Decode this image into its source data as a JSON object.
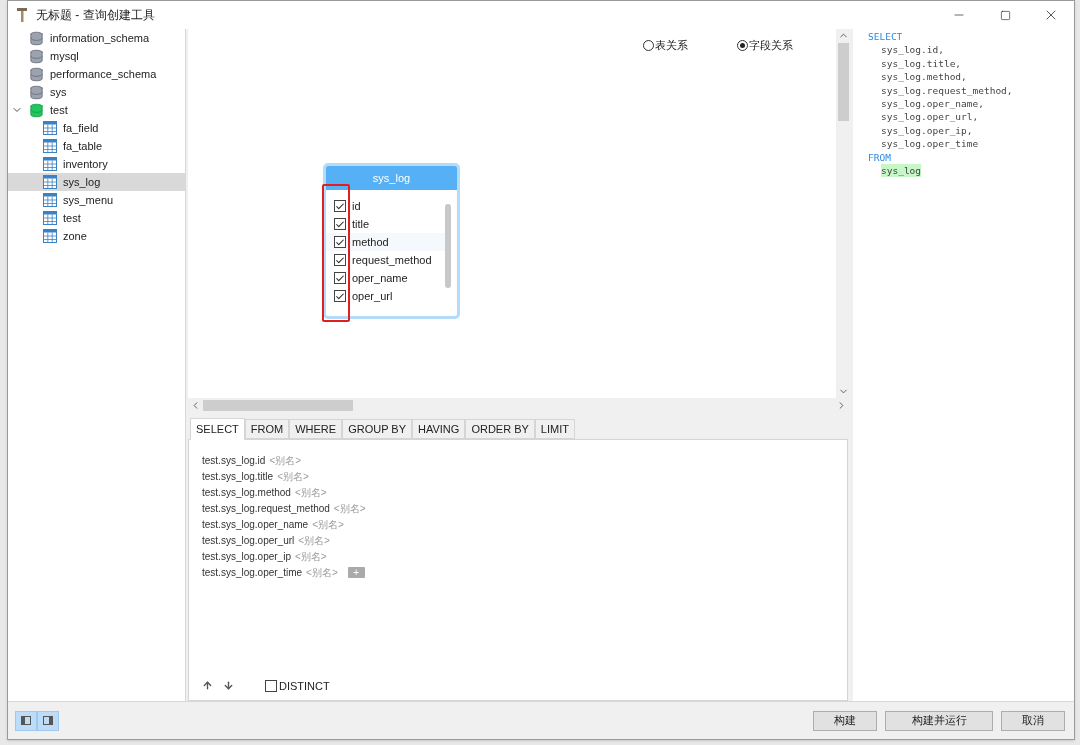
{
  "window": {
    "title": "无标题 - 查询创建工具"
  },
  "sidebar": {
    "items": [
      {
        "label": "information_schema",
        "kind": "database",
        "active": false,
        "expanded": false,
        "selected": false
      },
      {
        "label": "mysql",
        "kind": "database",
        "active": false,
        "expanded": false,
        "selected": false
      },
      {
        "label": "performance_schema",
        "kind": "database",
        "active": false,
        "expanded": false,
        "selected": false
      },
      {
        "label": "sys",
        "kind": "database",
        "active": false,
        "expanded": false,
        "selected": false
      },
      {
        "label": "test",
        "kind": "database",
        "active": true,
        "expanded": true,
        "selected": false,
        "children": [
          {
            "label": "fa_field",
            "kind": "table",
            "selected": false
          },
          {
            "label": "fa_table",
            "kind": "table",
            "selected": false
          },
          {
            "label": "inventory",
            "kind": "table",
            "selected": false
          },
          {
            "label": "sys_log",
            "kind": "table",
            "selected": true
          },
          {
            "label": "sys_menu",
            "kind": "table",
            "selected": false
          },
          {
            "label": "test",
            "kind": "table",
            "selected": false
          },
          {
            "label": "zone",
            "kind": "table",
            "selected": false
          }
        ]
      }
    ]
  },
  "view_options": [
    {
      "label": "表关系",
      "selected": false
    },
    {
      "label": "字段关系",
      "selected": true
    }
  ],
  "table_card": {
    "title": "sys_log",
    "fields": [
      {
        "name": "id",
        "checked": true
      },
      {
        "name": "title",
        "checked": true
      },
      {
        "name": "method",
        "checked": true
      },
      {
        "name": "request_method",
        "checked": true
      },
      {
        "name": "oper_name",
        "checked": true
      },
      {
        "name": "oper_url",
        "checked": true
      }
    ]
  },
  "clause_tabs": [
    {
      "label": "SELECT",
      "selected": true
    },
    {
      "label": "FROM",
      "selected": false
    },
    {
      "label": "WHERE",
      "selected": false
    },
    {
      "label": "GROUP BY",
      "selected": false
    },
    {
      "label": "HAVING",
      "selected": false
    },
    {
      "label": "ORDER BY",
      "selected": false
    },
    {
      "label": "LIMIT",
      "selected": false
    }
  ],
  "select_items": [
    {
      "field": "test.sys_log.id",
      "alias": "<别名>"
    },
    {
      "field": "test.sys_log.title",
      "alias": "<别名>"
    },
    {
      "field": "test.sys_log.method",
      "alias": "<别名>"
    },
    {
      "field": "test.sys_log.request_method",
      "alias": "<别名>"
    },
    {
      "field": "test.sys_log.oper_name",
      "alias": "<别名>"
    },
    {
      "field": "test.sys_log.oper_url",
      "alias": "<别名>"
    },
    {
      "field": "test.sys_log.oper_ip",
      "alias": "<别名>"
    },
    {
      "field": "test.sys_log.oper_time",
      "alias": "<别名>"
    }
  ],
  "add_button": "+",
  "distinct": {
    "label": "DISTINCT",
    "checked": false
  },
  "sql": {
    "lines": [
      {
        "kind": "keyword",
        "text": "SELECT"
      },
      {
        "kind": "code",
        "text": "sys_log.id,"
      },
      {
        "kind": "code",
        "text": "sys_log.title,"
      },
      {
        "kind": "code",
        "text": "sys_log.method,"
      },
      {
        "kind": "code",
        "text": "sys_log.request_method,"
      },
      {
        "kind": "code",
        "text": "sys_log.oper_name,"
      },
      {
        "kind": "code",
        "text": "sys_log.oper_url,"
      },
      {
        "kind": "code",
        "text": "sys_log.oper_ip,"
      },
      {
        "kind": "code",
        "text": "sys_log.oper_time"
      },
      {
        "kind": "keyword",
        "text": "FROM"
      },
      {
        "kind": "table",
        "text": "sys_log"
      }
    ]
  },
  "buttons": [
    "构建",
    "构建并运行",
    "取消"
  ]
}
